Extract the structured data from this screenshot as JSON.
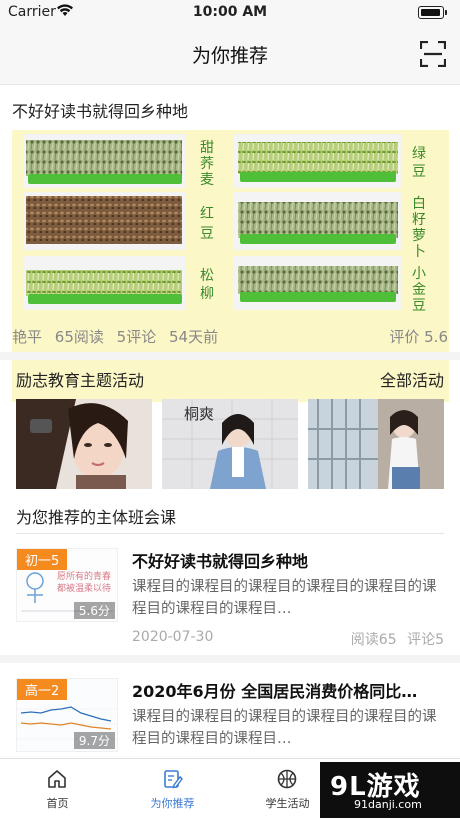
{
  "status_bar": {
    "carrier": "Carrier",
    "time": "10:00 AM"
  },
  "nav": {
    "title": "为你推荐",
    "scan_icon": "scan-icon"
  },
  "featured": {
    "title": "不好好读书就得回乡种地",
    "sprout_labels": [
      "甜荞麦",
      "绿豆",
      "红豆",
      "白籽萝卜",
      "松柳",
      "小金豆"
    ],
    "meta": {
      "author": "艳平",
      "reads": "65阅读",
      "comments": "5评论",
      "time": "54天前"
    },
    "rating": "评价 5.6"
  },
  "activities": {
    "section_title": "励志教育主题活动",
    "all_label": "全部活动"
  },
  "courses": {
    "section_title": "为您推荐的主体班会课",
    "items": [
      {
        "grade": "初一5",
        "score": "5.6分",
        "thumb_text": [
          "愿所有的青春",
          "都被温柔以待"
        ],
        "title": "不好好读书就得回乡种地",
        "desc": "课程目的课程目的课程目的课程目的课程目的课程目的课程目的课程目…",
        "date": "2020-07-30",
        "reads": "阅读65",
        "comments": "评论5"
      },
      {
        "grade": "高一2",
        "score": "9.7分",
        "title": "2020年6月份 全国居民消费价格同比…",
        "desc": "课程目的课程目的课程目的课程目的课程目的课程目的课程目的课程目…"
      }
    ]
  },
  "tabbar": {
    "tabs": [
      {
        "label": "首页",
        "icon": "home-icon"
      },
      {
        "label": "为你推荐",
        "icon": "edit-icon",
        "active": true
      },
      {
        "label": "学生活动",
        "icon": "basketball-icon"
      }
    ]
  },
  "watermark": {
    "brand": "9L游戏",
    "site": "91danji.com"
  },
  "colors": {
    "accent": "#3a7bd5",
    "grade_badge": "#f58a1f",
    "meta_text": "#888888"
  }
}
